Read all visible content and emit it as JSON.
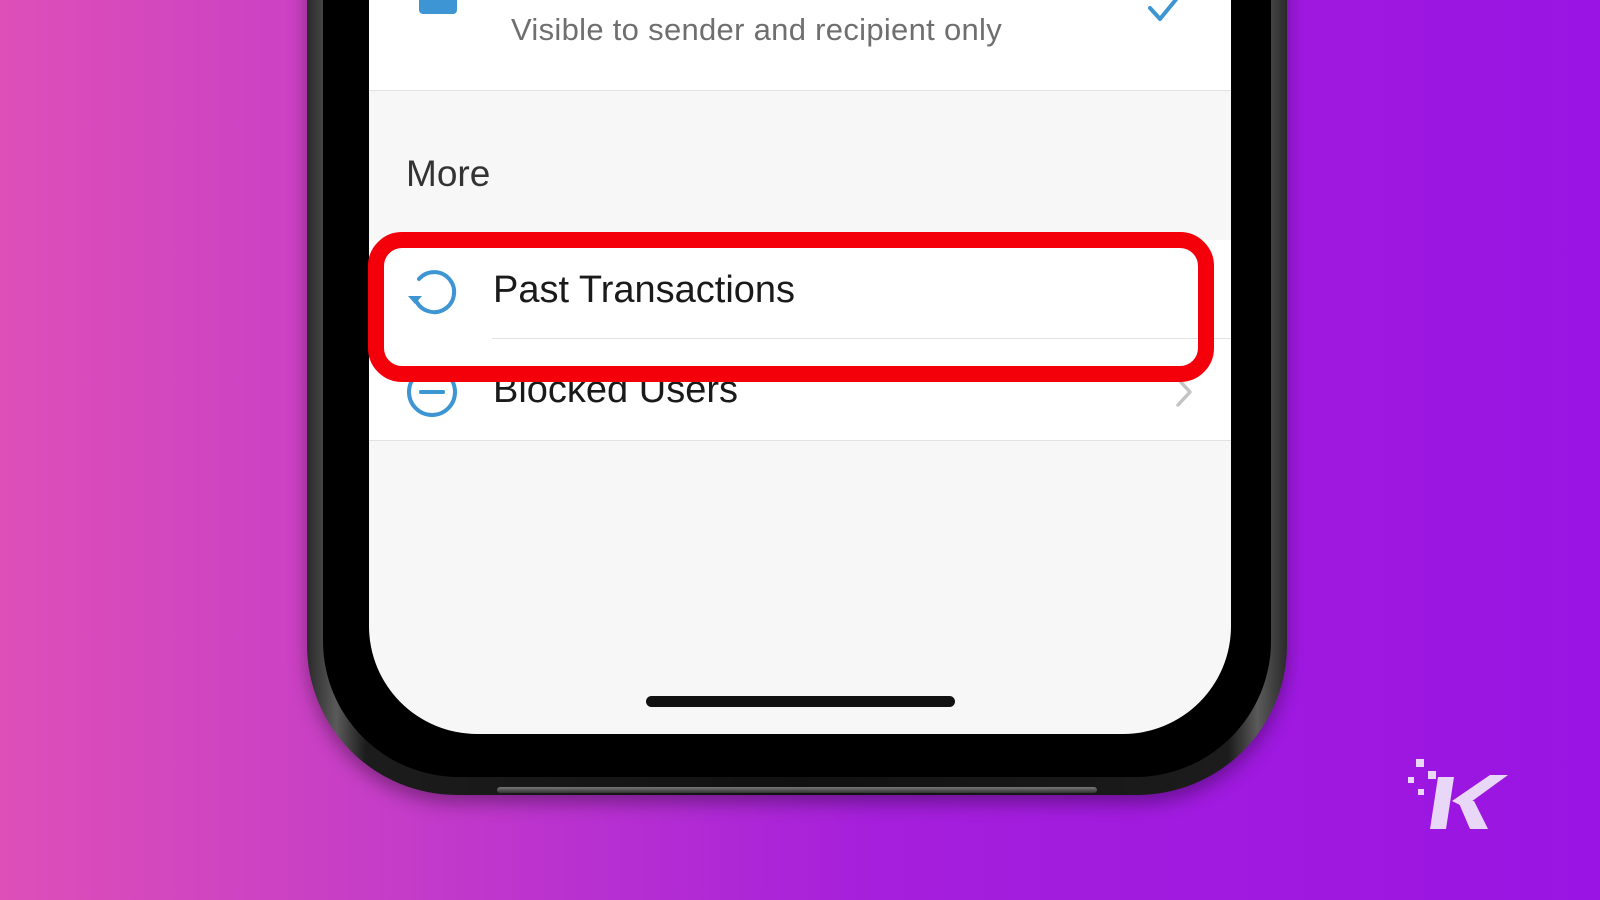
{
  "privacy_option": {
    "subtitle": "Visible to sender and recipient only",
    "selected": true,
    "check_icon": "checkmark-icon",
    "icon": "square-icon"
  },
  "more_section": {
    "title": "More",
    "items": [
      {
        "label": "Past Transactions",
        "icon": "history-icon",
        "highlighted": true
      },
      {
        "label": "Blocked Users",
        "icon": "minus-circle-icon",
        "chevron": "chevron-right-icon"
      }
    ]
  },
  "colors": {
    "accent": "#3d95d3",
    "highlight": "#f4000a",
    "background_left": "#de4fb8",
    "background_right": "#9a14e3"
  },
  "watermark": {
    "icon": "knowtechie-logo"
  }
}
